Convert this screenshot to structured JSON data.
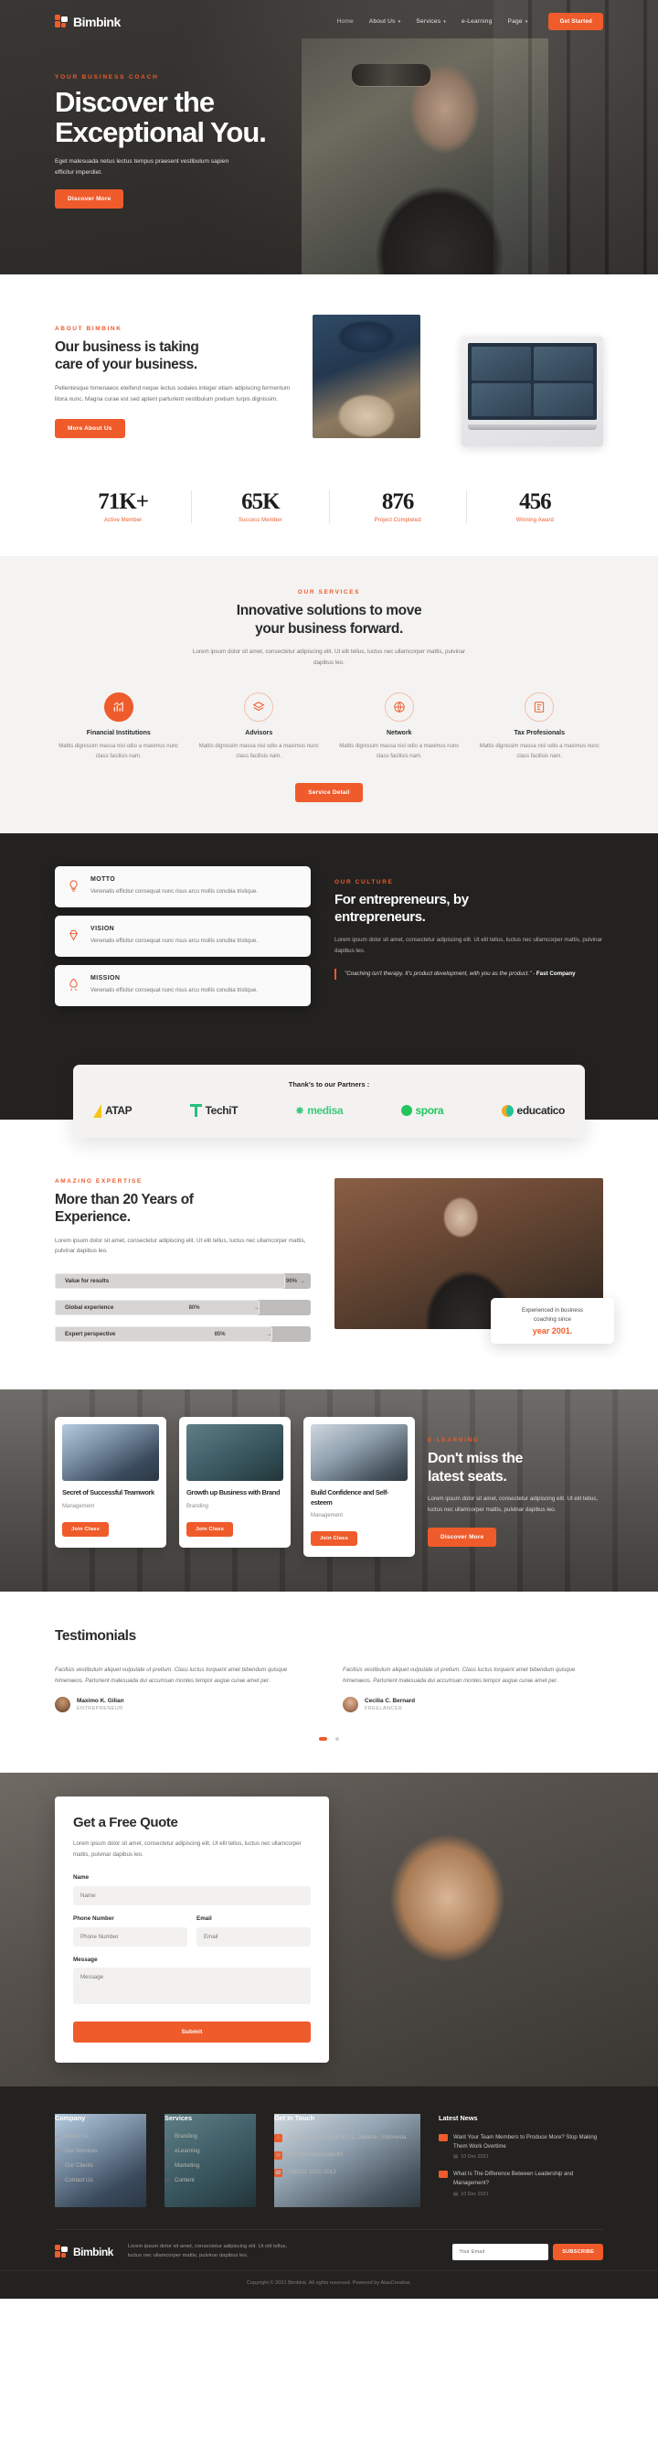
{
  "brand": {
    "name": "Bimbink"
  },
  "nav": {
    "links": [
      {
        "label": "Home",
        "caret": false
      },
      {
        "label": "About Us",
        "caret": true
      },
      {
        "label": "Services",
        "caret": true
      },
      {
        "label": "e-Learning",
        "caret": false
      },
      {
        "label": "Page",
        "caret": true
      }
    ],
    "cta": "Get Started"
  },
  "hero": {
    "eyebrow": "YOUR BUSINESS COACH",
    "title_line1": "Discover the",
    "title_line2": "Exceptional You.",
    "subtitle": "Eget malesuada netus lectus tempus praesent vestibulum sapien efficitur imperdiet.",
    "cta": "Discover More"
  },
  "about": {
    "eyebrow": "ABOUT BIMBINK",
    "title_line1": "Our business is taking",
    "title_line2": "care of your business.",
    "body": "Pellentesque himenaeos eleifend neque lectus sodales integer etiam adipiscing fermentum litora nunc. Magna curae est sed aptent parturient vestibulum pretium turpis dignissim.",
    "cta": "More About Us"
  },
  "stats": [
    {
      "value": "71K+",
      "label": "Active Member"
    },
    {
      "value": "65K",
      "label": "Success Member"
    },
    {
      "value": "876",
      "label": "Project Completed"
    },
    {
      "value": "456",
      "label": "Winning Award"
    }
  ],
  "services": {
    "eyebrow": "OUR SERVICES",
    "title_line1": "Innovative solutions to move",
    "title_line2": "your business forward.",
    "lead": "Lorem ipsum dolor sit amet, consectetur adipiscing elit. Ut elit tellus, luctus nec ullamcorper mattis, pulvinar dapibus leo.",
    "items": [
      {
        "icon": "chart-bar-icon",
        "glyph": "ὌA",
        "title": "Financial Institutions",
        "text": "Mattis dignissim massa nisl odio a maximus nunc class facilisis nam."
      },
      {
        "icon": "layers-icon",
        "glyph": "≡",
        "title": "Advisors",
        "text": "Mattis dignissim massa nisl odio a maximus nunc class facilisis nam."
      },
      {
        "icon": "globe-icon",
        "glyph": "⊕",
        "title": "Network",
        "text": "Mattis dignissim massa nisl odio a maximus nunc class facilisis nam."
      },
      {
        "icon": "tax-document-icon",
        "glyph": "▤",
        "title": "Tax Profesionals",
        "text": "Mattis dignissim massa nisl odio a maximus nunc class facilisis nam."
      }
    ],
    "cta": "Service Detail"
  },
  "culture": {
    "cards": [
      {
        "icon": "lightbulb-icon",
        "glyph": "Ὂ1",
        "title": "MOTTO",
        "text": "Venenatis efficitur consequat nunc risus arcu mollis conubia tristique."
      },
      {
        "icon": "diamond-icon",
        "glyph": "◆",
        "title": "VISION",
        "text": "Venenatis efficitur consequat nunc risus arcu mollis conubia tristique."
      },
      {
        "icon": "rocket-icon",
        "glyph": "Ὠ0",
        "title": "MISSION",
        "text": "Venenatis efficitur consequat nunc risus arcu mollis conubia tristique."
      }
    ],
    "eyebrow": "OUR CULTURE",
    "title_line1": "For entrepreneurs, by",
    "title_line2": "entrepreneurs.",
    "lead": "Lorem ipsum dolor sit amet, consectetur adipiscing elit. Ut elit tellus, luctus nec ullamcorper mattis, pulvinar dapibus leo.",
    "quote": "\"Coaching isn't therapy. It's product development, with you as the product.\" - ",
    "quote_source": "Fast Company"
  },
  "partners": {
    "title": "Thank's to our Partners :",
    "logos": [
      "ATAP",
      "TechiT",
      "medisa",
      "spora",
      "educatico"
    ]
  },
  "experience": {
    "eyebrow": "AMAZING EXPERTISE",
    "title_line1": "More than 20 Years of",
    "title_line2": "Experience.",
    "lead": "Lorem ipsum dolor sit amet, consectetur adipiscing elit. Ut elit tellus, luctus nec ullamcorper mattis, pulvinar dapibus leo.",
    "bars": [
      {
        "label": "Value for results",
        "pct": "90%",
        "value": 90
      },
      {
        "label": "Global experience",
        "pct": "80%",
        "value": 80
      },
      {
        "label": "Expert perspective",
        "pct": "85%",
        "value": 85
      }
    ],
    "badge_line1": "Experienced in business",
    "badge_line2": "coaching since",
    "badge_year": "year 2001."
  },
  "elearning": {
    "courses": [
      {
        "title": "Secret of Successful Teamwork",
        "category": "Management",
        "cta": "Join Class"
      },
      {
        "title": "Growth up Business with Brand",
        "category": "Branding",
        "cta": "Join Class"
      },
      {
        "title": "Build Confidence and Self-esteem",
        "category": "Management",
        "cta": "Join Class"
      }
    ],
    "eyebrow": "E-LEARNING",
    "title_line1": "Don't miss the",
    "title_line2": "latest seats.",
    "lead": "Lorem ipsum dolor sit amet, consectetur adipiscing elit. Ut elit tellus, luctus nec ullamcorper mattis, pulvinar dapibus leo.",
    "cta": "Discover More"
  },
  "testimonials": {
    "title": "Testimonials",
    "items": [
      {
        "text": "Facilisis vestibulum aliquet vulputate ut pretium. Class luctus torquent amet bibendum quisque himenaeos. Parturient malesuada dui accumsan montes tempor augue curae amet per.",
        "name": "Maximo K. Gilian",
        "role": "ENTREPRENEUR"
      },
      {
        "text": "Facilisis vestibulum aliquet vulputate ut pretium. Class luctus torquent amet bibendum quisque himenaeos. Parturient malesuada dui accumsan montes tempor augue curae amet per.",
        "name": "Cecilia C. Bernard",
        "role": "FREELANCER"
      }
    ]
  },
  "quote_form": {
    "title": "Get a Free Quote",
    "lead": "Lorem ipsum dolor sit amet, consectetur adipiscing elit. Ut elit tellus, luctus nec ullamcorper mattis, pulvinar dapibus leo.",
    "name_label": "Name",
    "name_placeholder": "Name",
    "phone_label": "Phone Number",
    "phone_placeholder": "Phone Number",
    "email_label": "Email",
    "email_placeholder": "Email",
    "message_label": "Message",
    "message_placeholder": "Message",
    "submit": "Submit"
  },
  "footer": {
    "company": {
      "title": "Company",
      "links": [
        "About Us",
        "Our Services",
        "Our Clients",
        "Contact Us"
      ]
    },
    "services": {
      "title": "Services",
      "links": [
        "Branding",
        "eLearning",
        "Marketing",
        "Content"
      ]
    },
    "contact": {
      "title": "Get In Touch",
      "address": "Jln Cempaka Wangi No 22. Jakarta - Indonesia",
      "email": "hello@yourdomain.tld",
      "phone": "+(62)21 2002-2012"
    },
    "news": {
      "title": "Latest News",
      "items": [
        {
          "title": "Want Your Team Members to Produce More? Stop Making Them Work Overtime",
          "date": "10 Dec 2021"
        },
        {
          "title": "What Is The Difference Between Leadership and Management?",
          "date": "10 Dec 2021"
        }
      ]
    },
    "bottom_about": "Lorem ipsum dolor sit amet, consectetur adipiscing elit. Ut elit tellus, luctus nec ullamcorper mattis, pulvinar dapibus leo.",
    "subscribe_placeholder": "Your Email",
    "subscribe_button": "SUBSCRIBE",
    "copyright": "Copyright © 2021 Bimbink. All rights reserved. Powered by AtasCreative."
  },
  "colors": {
    "accent": "#ef5b2b",
    "dark": "#232220",
    "light": "#f4f3f2"
  }
}
